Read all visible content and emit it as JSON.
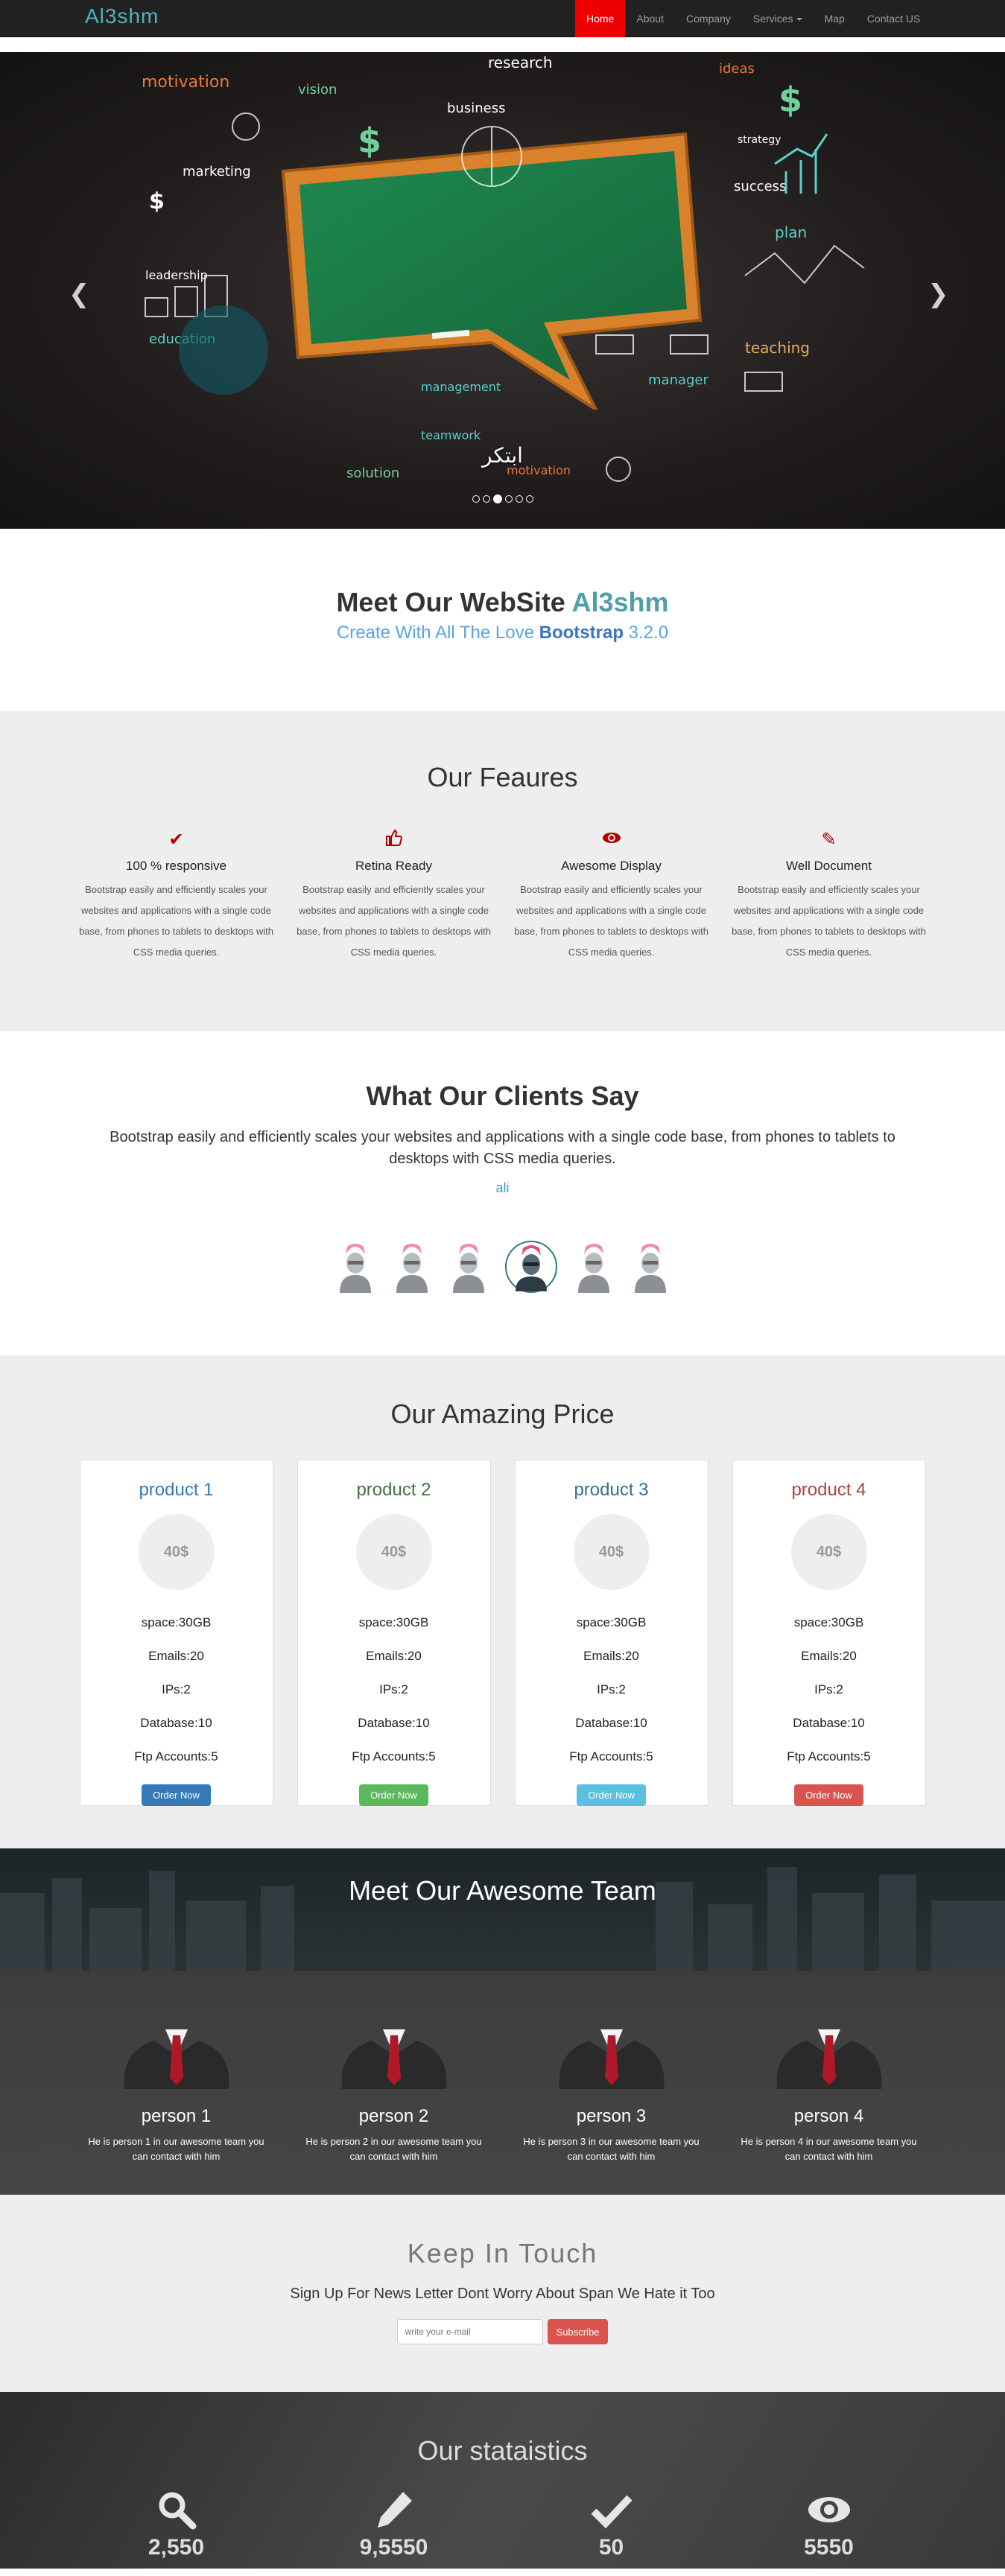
{
  "nav": {
    "brand": "Al3shm",
    "items": [
      {
        "label": "Home",
        "active": true
      },
      {
        "label": "About"
      },
      {
        "label": "Company"
      },
      {
        "label": "Services",
        "dropdown": true
      },
      {
        "label": "Map"
      },
      {
        "label": "Contact US"
      }
    ]
  },
  "carousel": {
    "caption": "ابتكر",
    "slide_count": 6,
    "active_index": 2,
    "doodles": [
      "motivation",
      "marketing",
      "vision",
      "research",
      "business",
      "ideas",
      "strategy",
      "success",
      "plan",
      "leadership",
      "education",
      "teaching",
      "manager",
      "management",
      "teamwork",
      "solution",
      "motivation"
    ]
  },
  "intro": {
    "title_prefix": "Meet Our WebSite",
    "title_highlight": "Al3shm",
    "subtitle_prefix": "Create With All The Love",
    "subtitle_bold": "Bootstrap",
    "subtitle_suffix": "3.2.0"
  },
  "features": {
    "title": "Our Feaures",
    "items": [
      {
        "icon": "check-icon",
        "title": "100 % responsive",
        "text": "Bootstrap easily and efficiently scales your websites and applications with a single code base, from phones to tablets to desktops with CSS media queries."
      },
      {
        "icon": "thumbs-up-icon",
        "title": "Retina Ready",
        "text": "Bootstrap easily and efficiently scales your websites and applications with a single code base, from phones to tablets to desktops with CSS media queries."
      },
      {
        "icon": "eye-icon",
        "title": "Awesome Display",
        "text": "Bootstrap easily and efficiently scales your websites and applications with a single code base, from phones to tablets to desktops with CSS media queries."
      },
      {
        "icon": "pencil-icon",
        "title": "Well Document",
        "text": "Bootstrap easily and efficiently scales your websites and applications with a single code base, from phones to tablets to desktops with CSS media queries."
      }
    ]
  },
  "clients": {
    "title": "What Our Clients Say",
    "quote": "Bootstrap easily and efficiently scales your websites and applications with a single code base, from phones to tablets to desktops with CSS media queries.",
    "author": "ali",
    "avatar_count": 6,
    "selected_avatar": 3
  },
  "prices": {
    "title": "Our Amazing Price",
    "plans": [
      {
        "name": "product 1",
        "price": "40$",
        "features": [
          "space:30GB",
          "Emails:20",
          "IPs:2",
          "Database:10",
          "Ftp Accounts:5"
        ],
        "button": "Order Now",
        "title_color": "#337ab7",
        "button_color": "#337ab7"
      },
      {
        "name": "product 2",
        "price": "40$",
        "features": [
          "space:30GB",
          "Emails:20",
          "IPs:2",
          "Database:10",
          "Ftp Accounts:5"
        ],
        "button": "Order Now",
        "title_color": "#3c763d",
        "button_color": "#5cb85c"
      },
      {
        "name": "product 3",
        "price": "40$",
        "features": [
          "space:30GB",
          "Emails:20",
          "IPs:2",
          "Database:10",
          "Ftp Accounts:5"
        ],
        "button": "Order Now",
        "title_color": "#31708f",
        "button_color": "#5bc0de"
      },
      {
        "name": "product 4",
        "price": "40$",
        "features": [
          "space:30GB",
          "Emails:20",
          "IPs:2",
          "Database:10",
          "Ftp Accounts:5"
        ],
        "button": "Order Now",
        "title_color": "#a94442",
        "button_color": "#d9534f"
      }
    ]
  },
  "team": {
    "title": "Meet Our Awesome Team",
    "members": [
      {
        "name": "person 1",
        "bio": "He is person 1 in our awesome team you can contact with him"
      },
      {
        "name": "person 2",
        "bio": "He is person 2 in our awesome team you can contact with him"
      },
      {
        "name": "person 3",
        "bio": "He is person 3 in our awesome team you can contact with him"
      },
      {
        "name": "person 4",
        "bio": "He is person 4 in our awesome team you can contact with him"
      }
    ]
  },
  "newsletter": {
    "title": "Keep In Touch",
    "text": "Sign Up For News Letter Dont Worry About Span We Hate it Too",
    "placeholder": "write your e-mail",
    "button": "Subscribe"
  },
  "stats": {
    "title": "Our stataistics",
    "items": [
      {
        "icon": "search-icon",
        "value": "2,550"
      },
      {
        "icon": "pencil-icon",
        "value": "9,5550"
      },
      {
        "icon": "check-icon",
        "value": "50"
      },
      {
        "icon": "eye-icon",
        "value": "5550"
      }
    ]
  },
  "colors": {
    "brand": "#4fb3b9",
    "nav_active": "#ee0000",
    "feature_icon": "#b30000",
    "board_green": "#1e7a45",
    "board_frame": "#d9822b"
  }
}
